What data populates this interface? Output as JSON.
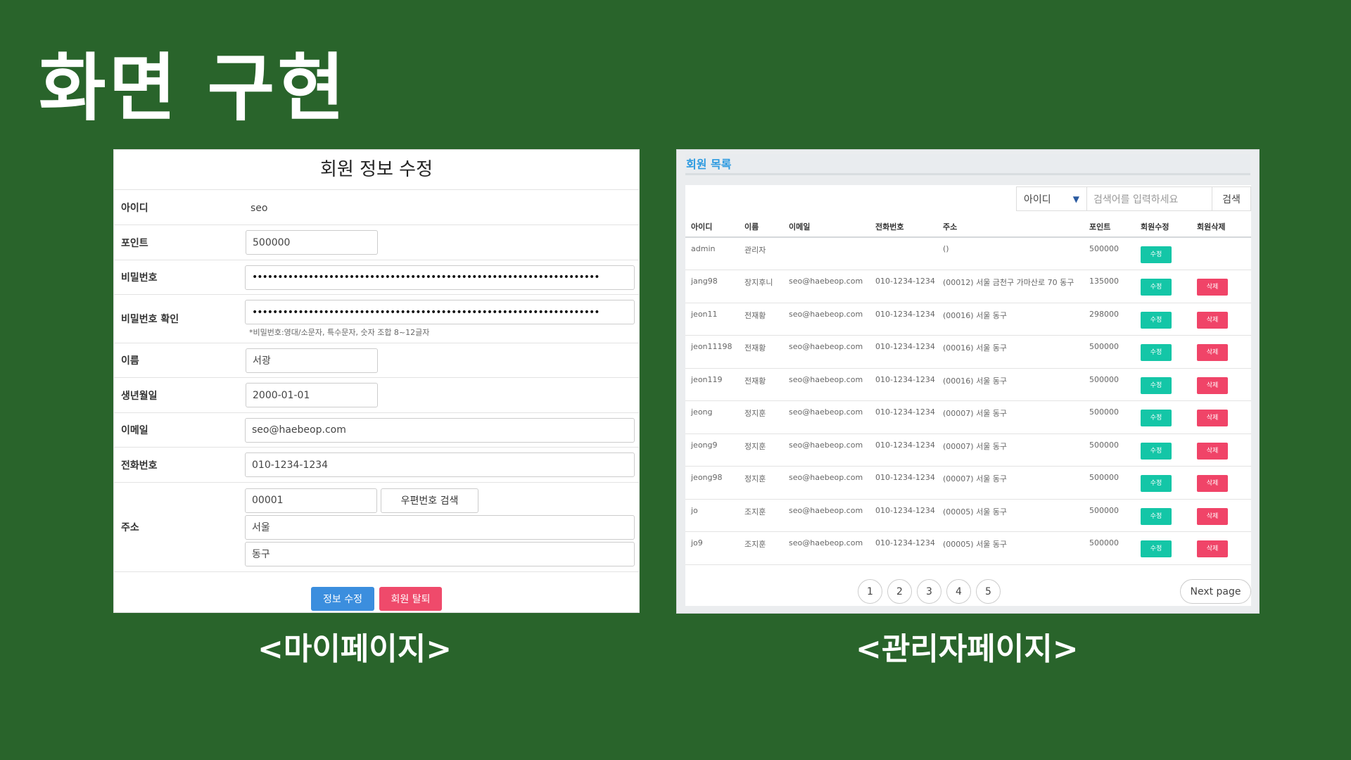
{
  "slide": {
    "title": "화면 구현",
    "caption_left": "<마이페이지>",
    "caption_right": "<관리자페이지>"
  },
  "mypage": {
    "title": "회원 정보 수정",
    "id_label": "아이디",
    "id_value": "seo",
    "point_label": "포인트",
    "point_value": "500000",
    "password_label": "비밀번호",
    "password_value": "••••••••••••••••••••••••••••••••••••••••••••••••••••••••••••••••••••",
    "password_confirm_label": "비밀번호 확인",
    "password_confirm_value": "••••••••••••••••••••••••••••••••••••••••••••••••••••••••••••••••••••",
    "password_hint": "*비밀번호:영대/소문자, 특수문자, 숫자 조합 8~12글자",
    "name_label": "이름",
    "name_value": "서광",
    "birth_label": "생년월일",
    "birth_value": "2000-01-01",
    "email_label": "이메일",
    "email_value": "seo@haebeop.com",
    "phone_label": "전화번호",
    "phone_value": "010-1234-1234",
    "address_label": "주소",
    "zipcode_value": "00001",
    "zipcode_search_label": "우편번호 검색",
    "address1_value": "서울",
    "address2_value": "동구",
    "submit_label": "정보 수정",
    "withdraw_label": "회원 탈퇴"
  },
  "admin": {
    "title": "회원 목록",
    "search_select": "아이디",
    "search_placeholder": "검색어를 입력하세요",
    "search_button": "검색",
    "columns": [
      "아이디",
      "이름",
      "이메일",
      "전화번호",
      "주소",
      "포인트",
      "회원수정",
      "회원삭제"
    ],
    "rows": [
      {
        "id": "admin",
        "name": "관리자",
        "email": "",
        "phone": "",
        "address": "()",
        "point": "500000",
        "edit": "수정",
        "delete": ""
      },
      {
        "id": "jang98",
        "name": "장지후니",
        "email": "seo@haebeop.com",
        "phone": "010-1234-1234",
        "address": "(00012) 서울 금천구 가마산로 70 동구",
        "point": "135000",
        "edit": "수정",
        "delete": "삭제"
      },
      {
        "id": "jeon11",
        "name": "전재황",
        "email": "seo@haebeop.com",
        "phone": "010-1234-1234",
        "address": "(00016) 서울 동구",
        "point": "298000",
        "edit": "수정",
        "delete": "삭제"
      },
      {
        "id": "jeon11198",
        "name": "전재황",
        "email": "seo@haebeop.com",
        "phone": "010-1234-1234",
        "address": "(00016) 서울 동구",
        "point": "500000",
        "edit": "수정",
        "delete": "삭제"
      },
      {
        "id": "jeon119",
        "name": "전재황",
        "email": "seo@haebeop.com",
        "phone": "010-1234-1234",
        "address": "(00016) 서울 동구",
        "point": "500000",
        "edit": "수정",
        "delete": "삭제"
      },
      {
        "id": "jeong",
        "name": "정지훈",
        "email": "seo@haebeop.com",
        "phone": "010-1234-1234",
        "address": "(00007) 서울 동구",
        "point": "500000",
        "edit": "수정",
        "delete": "삭제"
      },
      {
        "id": "jeong9",
        "name": "정지훈",
        "email": "seo@haebeop.com",
        "phone": "010-1234-1234",
        "address": "(00007) 서울 동구",
        "point": "500000",
        "edit": "수정",
        "delete": "삭제"
      },
      {
        "id": "jeong98",
        "name": "정지훈",
        "email": "seo@haebeop.com",
        "phone": "010-1234-1234",
        "address": "(00007) 서울 동구",
        "point": "500000",
        "edit": "수정",
        "delete": "삭제"
      },
      {
        "id": "jo",
        "name": "조지훈",
        "email": "seo@haebeop.com",
        "phone": "010-1234-1234",
        "address": "(00005) 서울 동구",
        "point": "500000",
        "edit": "수정",
        "delete": "삭제"
      },
      {
        "id": "jo9",
        "name": "조지훈",
        "email": "seo@haebeop.com",
        "phone": "010-1234-1234",
        "address": "(00005) 서울 동구",
        "point": "500000",
        "edit": "수정",
        "delete": "삭제"
      }
    ],
    "pages": [
      "1",
      "2",
      "3",
      "4",
      "5"
    ],
    "next_label": "Next page"
  },
  "colors": {
    "background": "#29642b",
    "primary_button": "#3b8ede",
    "danger_button": "#ef4a6b",
    "edit_button": "#14c6a7",
    "admin_title": "#2d9ae0"
  }
}
